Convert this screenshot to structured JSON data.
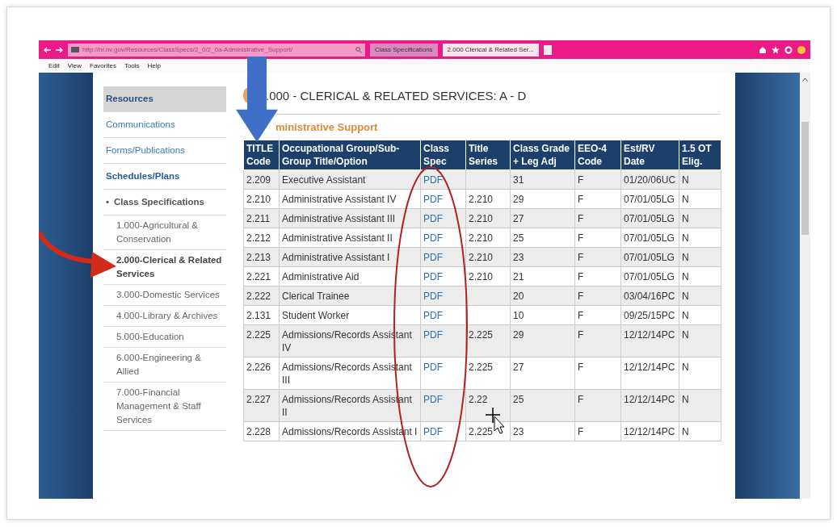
{
  "browser": {
    "url": "http://hr.nv.gov/Resources/ClassSpecs/2_0/2_0a-Administrative_Support/",
    "tabs": [
      {
        "label": "Class Specifications",
        "selected": false
      },
      {
        "label": "2.000 Clerical & Related Ser...",
        "selected": true
      }
    ],
    "menu": [
      "Edit",
      "View",
      "Favorites",
      "Tools",
      "Help"
    ]
  },
  "sidebar": {
    "items": [
      {
        "label": "Resources",
        "kind": "section",
        "selected": true
      },
      {
        "label": "Communications",
        "kind": "link"
      },
      {
        "label": "Forms/Publications",
        "kind": "link"
      },
      {
        "label": "Schedules/Plans",
        "kind": "heading"
      },
      {
        "label": "Class Specifications",
        "kind": "group",
        "marker": "•"
      },
      {
        "label": "1.000-Agricultural & Conservation",
        "kind": "page",
        "selected": false
      },
      {
        "label": "2.000-Clerical & Related Services",
        "kind": "page",
        "selected": true
      },
      {
        "label": "3.000-Domestic Services",
        "kind": "page",
        "selected": false
      },
      {
        "label": "4.000-Library & Archives",
        "kind": "page",
        "selected": false
      },
      {
        "label": "5.000-Education",
        "kind": "page",
        "selected": false
      },
      {
        "label": "6.000-Engineering & Allied",
        "kind": "page",
        "selected": false
      },
      {
        "label": "7.000-Financial Management & Staff Services",
        "kind": "page",
        "selected": false
      }
    ]
  },
  "heading": ".000 - CLERICAL & RELATED SERVICES: A - D",
  "subheading": "ministrative Support",
  "table": {
    "columns": [
      "TITLE Code",
      "Occupational Group/Sub-Group Title/Option",
      "Class Spec",
      "Title Series",
      "Class Grade + Leg Adj",
      "EEO-4 Code",
      "Est/RV Date",
      "1.5 OT Elig."
    ],
    "rows": [
      [
        "2.209",
        "Executive Assistant",
        "PDF",
        "",
        "31",
        "F",
        "01/20/06UC",
        "N"
      ],
      [
        "2.210",
        "Administrative Assistant IV",
        "PDF",
        "2.210",
        "29",
        "F",
        "07/01/05LG",
        "N"
      ],
      [
        "2.211",
        "Administrative Assistant III",
        "PDF",
        "2.210",
        "27",
        "F",
        "07/01/05LG",
        "N"
      ],
      [
        "2.212",
        "Administrative Assistant II",
        "PDF",
        "2.210",
        "25",
        "F",
        "07/01/05LG",
        "N"
      ],
      [
        "2.213",
        "Administrative Assistant I",
        "PDF",
        "2.210",
        "23",
        "F",
        "07/01/05LG",
        "N"
      ],
      [
        "2.221",
        "Administrative Aid",
        "PDF",
        "2.210",
        "21",
        "F",
        "07/01/05LG",
        "N"
      ],
      [
        "2.222",
        "Clerical Trainee",
        "PDF",
        "",
        "20",
        "F",
        "03/04/16PC",
        "N"
      ],
      [
        "2.131",
        "Student Worker",
        "PDF",
        "",
        "10",
        "F",
        "09/25/15PC",
        "N"
      ],
      [
        "2.225",
        "Admissions/Records Assistant IV",
        "PDF",
        "2.225",
        "29",
        "F",
        "12/12/14PC",
        "N"
      ],
      [
        "2.226",
        "Admissions/Records Assistant III",
        "PDF",
        "2.225",
        "27",
        "F",
        "12/12/14PC",
        "N"
      ],
      [
        "2.227",
        "Admissions/Records Assistant II",
        "PDF",
        "2.22",
        "25",
        "F",
        "12/12/14PC",
        "N"
      ],
      [
        "2.228",
        "Admissions/Records Assistant I",
        "PDF",
        "2.225",
        "23",
        "F",
        "12/12/14PC",
        "N"
      ]
    ]
  }
}
